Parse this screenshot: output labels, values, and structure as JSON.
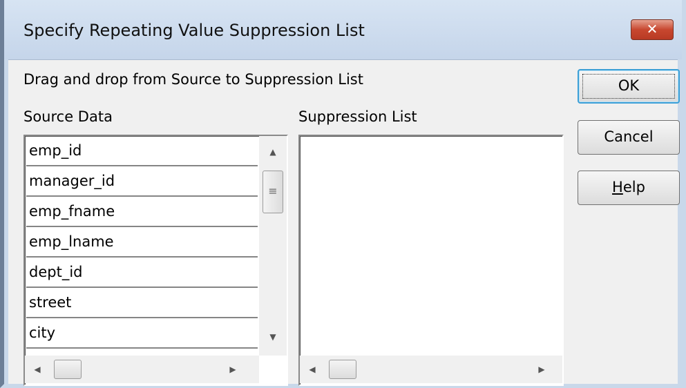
{
  "dialog": {
    "title": "Specify Repeating Value Suppression List",
    "close_glyph": "✕",
    "instruction": "Drag and drop from Source to Suppression List",
    "source": {
      "label": "Source Data",
      "items": [
        "emp_id",
        "manager_id",
        "emp_fname",
        "emp_lname",
        "dept_id",
        "street",
        "city"
      ]
    },
    "suppression": {
      "label": "Suppression List",
      "items": []
    },
    "buttons": {
      "ok_label": "OK",
      "cancel_label": "Cancel",
      "help_mnemonic": "H",
      "help_rest": "elp"
    },
    "icons": {
      "scroll_up": "▲",
      "scroll_down": "▼",
      "scroll_left": "◀",
      "scroll_right": "▶",
      "thumb_grip": "≡"
    }
  }
}
